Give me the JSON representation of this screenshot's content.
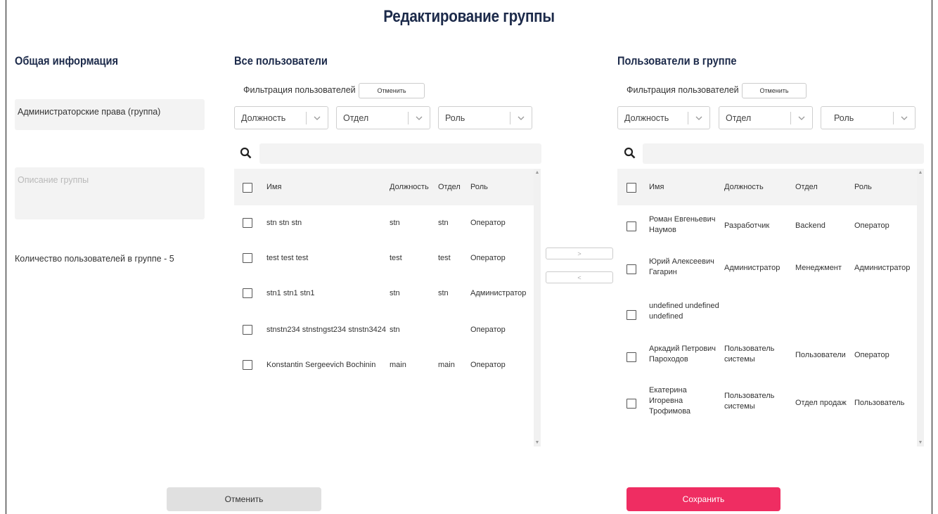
{
  "page": {
    "title": "Редактирование группы"
  },
  "general": {
    "heading": "Общая информация",
    "group_name": "Администраторские права (группа)",
    "description_placeholder": "Описание группы",
    "user_count": "Количество пользователей в группе - 5"
  },
  "all_users": {
    "heading": "Все пользователи",
    "filter_label": "Фильтрация пользователей",
    "cancel_filter": "Отменить",
    "selects": [
      "Должность",
      "Отдел",
      "Роль"
    ],
    "columns": [
      "Имя",
      "Должность",
      "Отдел",
      "Роль"
    ],
    "rows": [
      {
        "name": "stn stn stn",
        "position": "stn",
        "department": "stn",
        "role": "Оператор"
      },
      {
        "name": "test test test",
        "position": "test",
        "department": "test",
        "role": "Оператор"
      },
      {
        "name": "stn1 stn1 stn1",
        "position": "stn",
        "department": "stn",
        "role": "Администратор"
      },
      {
        "name": "stnstn234 stnstngst234 stnstn3424",
        "position": "stn",
        "department": "",
        "role": "Оператор"
      },
      {
        "name": "Konstantin Sergeevich Bochinin",
        "position": "main",
        "department": "main",
        "role": "Оператор"
      }
    ]
  },
  "transfer": {
    "add": ">",
    "remove": "<"
  },
  "group_users": {
    "heading": "Пользователи в группе",
    "filter_label": "Фильтрация пользователей",
    "cancel_filter": "Отменить",
    "selects": [
      "Должность",
      "Отдел",
      "Роль"
    ],
    "columns": [
      "Имя",
      "Должность",
      "Отдел",
      "Роль"
    ],
    "rows": [
      {
        "name": [
          "Роман Евгеньевич",
          "Наумов"
        ],
        "position": [
          "Разработчик"
        ],
        "department": "Backend",
        "role": "Оператор"
      },
      {
        "name": [
          "Юрий Алексеевич",
          "Гагарин"
        ],
        "position": [
          "Администратор"
        ],
        "department": "Менеджмент",
        "role": "Администратор"
      },
      {
        "name": [
          "undefined undefined",
          "undefined"
        ],
        "position": [],
        "department": "",
        "role": ""
      },
      {
        "name": [
          "Аркадий Петрович",
          "Пароходов"
        ],
        "position": [
          "Пользователь",
          "системы"
        ],
        "department": "Пользователи",
        "role": "Оператор"
      },
      {
        "name": [
          "Екатерина",
          "Игоревна",
          "Трофимова"
        ],
        "position": [
          "Пользователь",
          "системы"
        ],
        "department": "Отдел продаж",
        "role": "Пользователь"
      }
    ]
  },
  "footer": {
    "cancel": "Отменить",
    "save": "Сохранить"
  },
  "colors": {
    "heading": "#1c2a4a",
    "save": "#ef2d62",
    "field_bg": "#f3f3f3"
  },
  "icons": [
    "search-icon",
    "chevron-down-icon",
    "checkbox-icon"
  ]
}
